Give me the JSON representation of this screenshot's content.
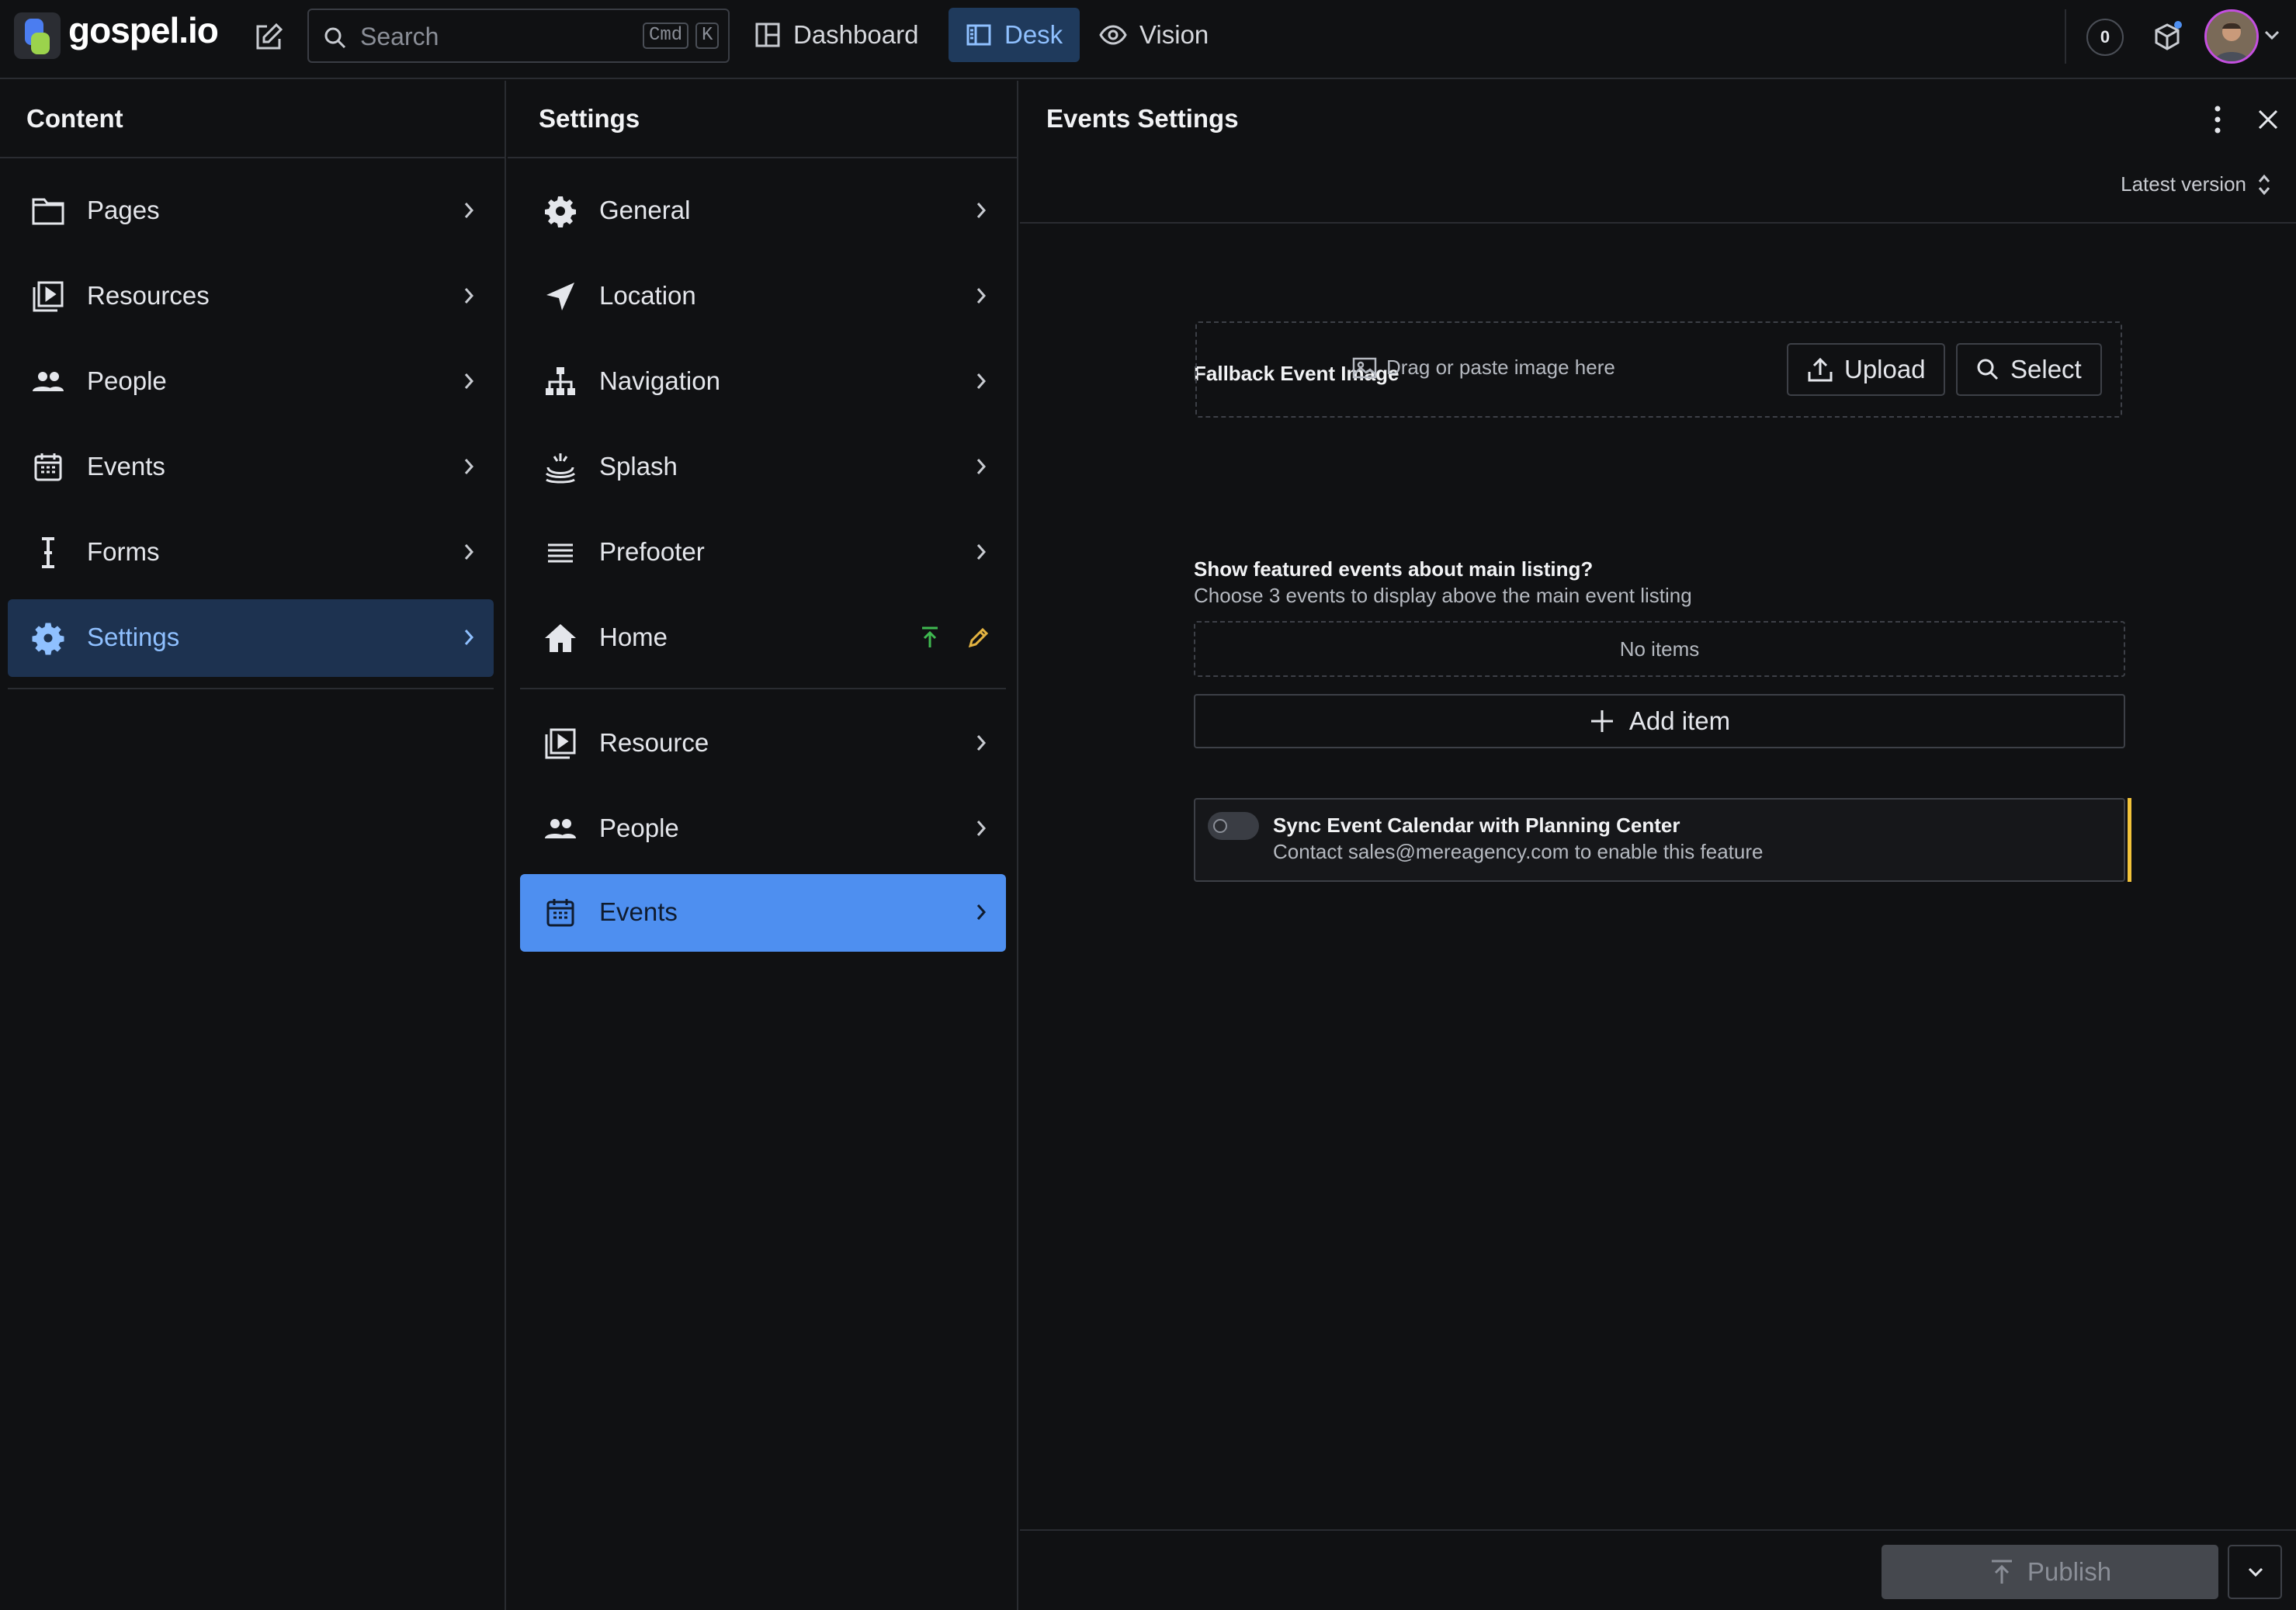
{
  "app": {
    "brand_name": "gospel.io",
    "search": {
      "placeholder": "Search",
      "shortcut_cmd": "Cmd",
      "shortcut_key": "K"
    },
    "tabs": [
      {
        "label": "Dashboard",
        "icon": "dashboard-icon",
        "active": false
      },
      {
        "label": "Desk",
        "icon": "desk-icon",
        "active": true
      },
      {
        "label": "Vision",
        "icon": "eye-icon",
        "active": false
      }
    ],
    "notification_count": "0"
  },
  "content_pane": {
    "title": "Content",
    "items": [
      {
        "label": "Pages",
        "icon": "folder-icon"
      },
      {
        "label": "Resources",
        "icon": "media-library-icon"
      },
      {
        "label": "People",
        "icon": "people-icon"
      },
      {
        "label": "Events",
        "icon": "calendar-icon"
      },
      {
        "label": "Forms",
        "icon": "text-cursor-icon"
      },
      {
        "label": "Settings",
        "icon": "gear-icon",
        "selected": true
      }
    ]
  },
  "settings_pane": {
    "title": "Settings",
    "items": [
      {
        "label": "General",
        "icon": "gear-icon"
      },
      {
        "label": "Location",
        "icon": "location-arrow-icon"
      },
      {
        "label": "Navigation",
        "icon": "sitemap-icon"
      },
      {
        "label": "Splash",
        "icon": "splash-icon"
      },
      {
        "label": "Prefooter",
        "icon": "lines-icon"
      },
      {
        "label": "Home",
        "icon": "home-icon",
        "status": "published-with-draft"
      }
    ],
    "types": [
      {
        "label": "Resource",
        "icon": "media-library-icon"
      },
      {
        "label": "People",
        "icon": "people-icon"
      },
      {
        "label": "Events",
        "icon": "calendar-icon",
        "selected": true
      }
    ]
  },
  "document": {
    "title": "Events Settings",
    "version": "Latest version",
    "fallback_image": {
      "label": "Fallback Event Image",
      "hint": "Drag or paste image here",
      "upload_label": "Upload",
      "select_label": "Select"
    },
    "featured": {
      "label": "Show featured events about main listing?",
      "description": "Choose 3 events to display above the main event listing",
      "empty_text": "No items",
      "add_label": "Add item"
    },
    "sync": {
      "title": "Sync Event Calendar with Planning Center",
      "description": "Contact sales@mereagency.com to enable this feature",
      "enabled": false
    },
    "publish_label": "Publish"
  },
  "colors": {
    "background": "#101113",
    "selected_dark": "#1d3250",
    "selected_blue": "#4e8ff0",
    "accent_warning": "#f2c33a",
    "published_green": "#3fb950",
    "draft_yellow": "#e3b341"
  }
}
